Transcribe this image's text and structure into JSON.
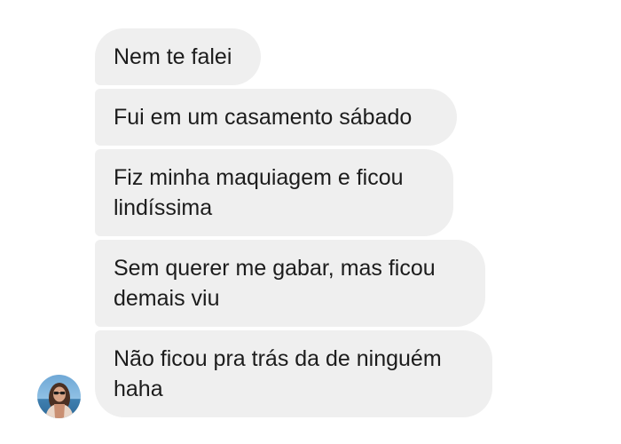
{
  "conversation": {
    "messages": [
      {
        "text": "Nem te falei"
      },
      {
        "text": "Fui em um casamento sábado"
      },
      {
        "text": "Fiz minha maquiagem e ficou\nlindíssima"
      },
      {
        "text": "Sem querer me gabar, mas ficou\ndemais viu"
      },
      {
        "text": "Não ficou pra trás da de ninguém\nhaha"
      }
    ],
    "sender": {
      "avatar": "profile-photo"
    }
  },
  "colors": {
    "bubble_background": "#efefef",
    "text": "#1c1c1c",
    "background": "#ffffff"
  }
}
